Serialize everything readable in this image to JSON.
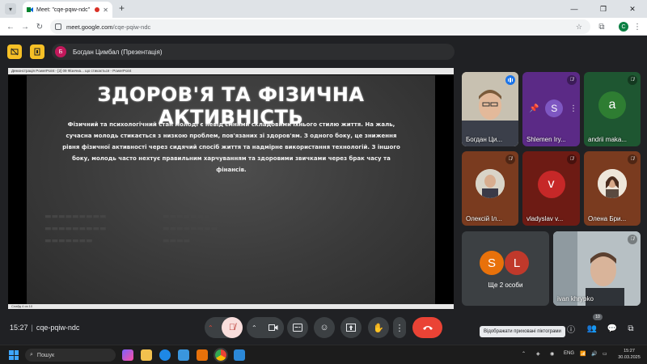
{
  "browser": {
    "tab_title": "Meet: \"cqe-pqiw-ndc\"",
    "url_host": "meet.google.com",
    "url_path": "/cqe-pqiw-ndc",
    "profile_initial": "C"
  },
  "presenter": {
    "avatar_initial": "Б",
    "label": "Богдан Цимбал (Презентація)"
  },
  "powerpoint": {
    "window_title": "Демонстрація PowerPoint - [2] 09 Фізична... що стикається - PowerPoint",
    "status_left": "Слайд 4 из 10"
  },
  "slide": {
    "title": "ЗДОРОВ'Я ТА ФІЗИЧНА АКТИВНІСТЬ",
    "body": "Фізичний та психологічний стан молоді є невід'ємними складовими їхнього стилю життя. На жаль, сучасна молодь стикається з низкою проблем, пов'язаних зі здоров'ям. З одного боку, це зниження рівня фізичної активності через сидячий спосіб життя та надмірне використання технологій. З іншого боку, молодь часто нехтує правильним харчуванням та здоровими звичками через брак часу та фінансів."
  },
  "participants": [
    {
      "name": "Богдан Ци...",
      "mic": "speaking"
    },
    {
      "name": "Shlemen Iry...",
      "initial": "S",
      "mic": "muted"
    },
    {
      "name": "andrii maka...",
      "initial": "a",
      "mic": "muted"
    },
    {
      "name": "Олексій Іл...",
      "mic": "muted"
    },
    {
      "name": "vladyslav v...",
      "initial": "v",
      "mic": "muted"
    },
    {
      "name": "Олена Бри...",
      "mic": "muted"
    },
    {
      "name": "Ще 2 особи",
      "initials": [
        "S",
        "L"
      ]
    },
    {
      "name": "ivan khrypko",
      "mic": "muted"
    }
  ],
  "bottom": {
    "time": "15:27",
    "meeting_code": "cqe-pqiw-ndc",
    "people_count": "10",
    "tooltip": "Відображати приховані піктограми"
  },
  "taskbar": {
    "search_placeholder": "Пошук",
    "lang": "ENG",
    "time": "15:27",
    "date": "30.03.2025"
  },
  "colors": {
    "meet_bg": "#202124",
    "accent_yellow": "#f6c026",
    "end_call_red": "#ea4335",
    "tile_purple": "#5b2a86",
    "tile_green": "#1e5631",
    "tile_brown": "#7a3b1f",
    "tile_darkred": "#6d1b14"
  }
}
